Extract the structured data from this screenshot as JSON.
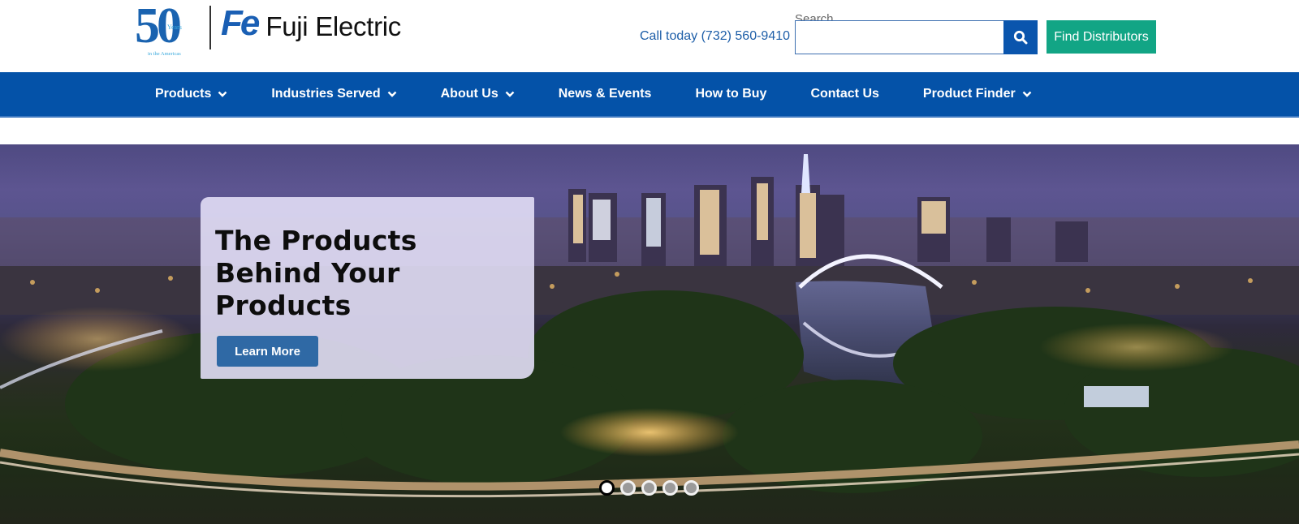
{
  "header": {
    "logo": {
      "anniversary_number": "50",
      "anniversary_years": "Years",
      "anniversary_region": "in the Americas",
      "brand_mark": "Fe",
      "brand_name": "Fuji Electric"
    },
    "call_today": "Call today (732) 560-9410",
    "search": {
      "label": "Search",
      "value": "",
      "placeholder": "",
      "button_icon": "search-icon"
    },
    "find_distributors_label": "Find Distributors",
    "colors": {
      "brand_blue": "#0452a8",
      "accent_green": "#12a585",
      "link_blue": "#1d5ea8"
    }
  },
  "nav": {
    "items": [
      {
        "label": "Products",
        "has_dropdown": true
      },
      {
        "label": "Industries Served",
        "has_dropdown": true
      },
      {
        "label": "About Us",
        "has_dropdown": true
      },
      {
        "label": "News & Events",
        "has_dropdown": false
      },
      {
        "label": "How to Buy",
        "has_dropdown": false
      },
      {
        "label": "Contact Us",
        "has_dropdown": false
      },
      {
        "label": "Product Finder",
        "has_dropdown": true
      }
    ]
  },
  "hero": {
    "title_line1": "The Products",
    "title_line2": "Behind Your Products",
    "cta_label": "Learn More",
    "background_description": "Night city skyline with illuminated arch bridge over river",
    "slides": {
      "count": 5,
      "active_index": 0
    }
  }
}
